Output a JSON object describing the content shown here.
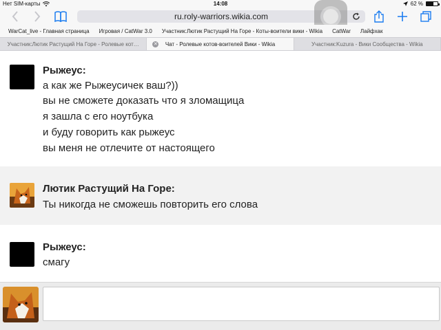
{
  "status_bar": {
    "carrier": "Нет SIM-карты",
    "time": "14:08",
    "battery": "62 %",
    "battery_level": 0.62
  },
  "toolbar": {
    "url": "ru.roly-warriors.wikia.com"
  },
  "bookmarks": [
    "WarCat_live - Главная страница",
    "Игровая / CatWar 3.0",
    "Участник:Лютик Растущий На Горе - Коты-воители вики - Wikia",
    "CatWar",
    "Лайфхак"
  ],
  "tabs": [
    {
      "label": "Участник:Лютик Растущий На Горе - Ролевые кот…",
      "active": false
    },
    {
      "label": "Чат - Ролевые котов-воителей Вики - Wikia",
      "active": true
    },
    {
      "label": "Участник:Kuzura - Вики Сообщества - Wikia",
      "active": false
    }
  ],
  "messages": [
    {
      "author": "Рыжеус:",
      "lines": [
        "а как же Рыжеусичек ваш?))",
        "вы не сможете доказать что я зломащица",
        "я зашла с его ноутбука",
        "и буду говорить как рыжеус",
        "вы меня не отлечите от настоящего"
      ]
    },
    {
      "author": "Лютик Растущий На Горе:",
      "lines": [
        "Ты никогда не сможешь повторить его слова"
      ]
    },
    {
      "author": "Рыжеус:",
      "lines": [
        "смагу"
      ]
    }
  ],
  "input": {
    "value": ""
  },
  "colors": {
    "accent": "#1a7cf0",
    "alt_row": "#f2f2f2"
  }
}
